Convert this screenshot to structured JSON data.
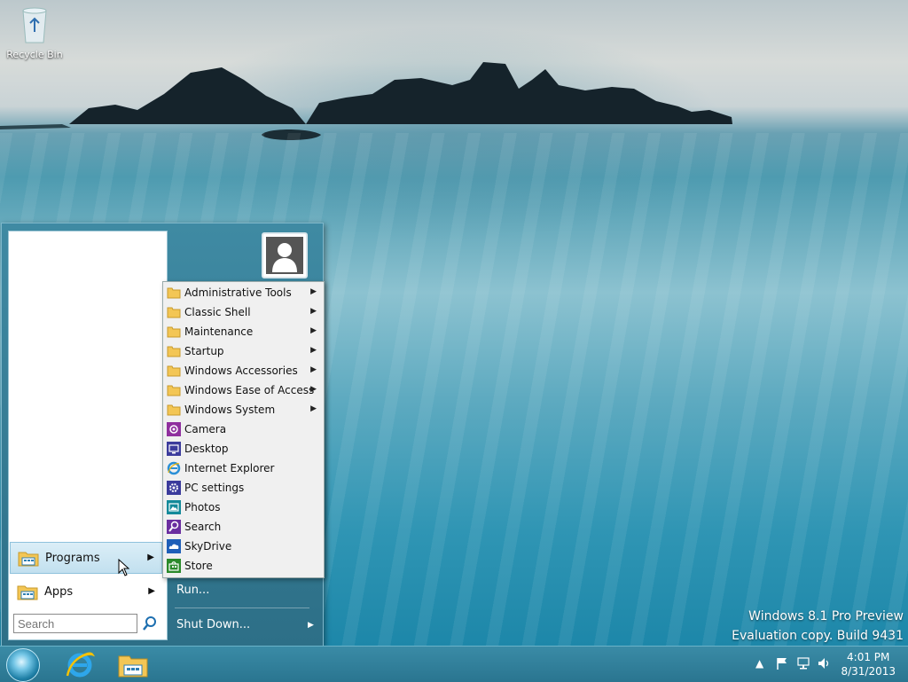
{
  "desktop": {
    "icons": [
      {
        "label": "Recycle Bin",
        "icon": "recycle-bin-icon"
      }
    ],
    "watermark": {
      "line1": "Windows 8.1 Pro Preview",
      "line2": "Evaluation copy. Build 9431"
    }
  },
  "start_menu": {
    "left_items": [
      {
        "label": "Programs",
        "icon": "programs-folder-icon",
        "highlighted": true
      },
      {
        "label": "Apps",
        "icon": "apps-folder-icon"
      }
    ],
    "search": {
      "placeholder": "Search",
      "value": ""
    },
    "right_items": [
      {
        "label": "Run..."
      },
      {
        "label": "Shut Down..."
      }
    ],
    "user_icon": "user-avatar-icon"
  },
  "programs_submenu": {
    "items": [
      {
        "label": "Administrative Tools",
        "icon": "folder-icon",
        "submenu": true
      },
      {
        "label": "Classic Shell",
        "icon": "folder-icon",
        "submenu": true
      },
      {
        "label": "Maintenance",
        "icon": "folder-icon",
        "submenu": true
      },
      {
        "label": "Startup",
        "icon": "folder-icon",
        "submenu": true
      },
      {
        "label": "Windows Accessories",
        "icon": "folder-icon",
        "submenu": true
      },
      {
        "label": "Windows Ease of Access",
        "icon": "folder-icon",
        "submenu": true
      },
      {
        "label": "Windows System",
        "icon": "folder-icon",
        "submenu": true
      },
      {
        "label": "Camera",
        "icon": "camera-icon",
        "color": "#8f2f9e"
      },
      {
        "label": "Desktop",
        "icon": "desktop-icon",
        "color": "#3b3b9c"
      },
      {
        "label": "Internet Explorer",
        "icon": "internet-explorer-icon",
        "color": "#2a8fd6"
      },
      {
        "label": "PC settings",
        "icon": "settings-gear-icon",
        "color": "#3b3b9c"
      },
      {
        "label": "Photos",
        "icon": "photos-icon",
        "color": "#138a9a"
      },
      {
        "label": "Search",
        "icon": "search-icon",
        "color": "#6a2ea0"
      },
      {
        "label": "SkyDrive",
        "icon": "skydrive-icon",
        "color": "#1f5fb8"
      },
      {
        "label": "Store",
        "icon": "store-icon",
        "color": "#2a8a2a"
      }
    ]
  },
  "taskbar": {
    "buttons": [
      {
        "name": "start-orb",
        "icon": "start-orb-icon"
      },
      {
        "name": "internet-explorer",
        "icon": "internet-explorer-icon"
      },
      {
        "name": "file-explorer",
        "icon": "file-explorer-icon"
      }
    ],
    "tray": {
      "icons": [
        "show-hidden-icons-chevron",
        "action-center-flag-icon",
        "network-icon",
        "volume-icon"
      ]
    },
    "clock": {
      "time": "4:01 PM",
      "date": "8/31/2013"
    }
  }
}
